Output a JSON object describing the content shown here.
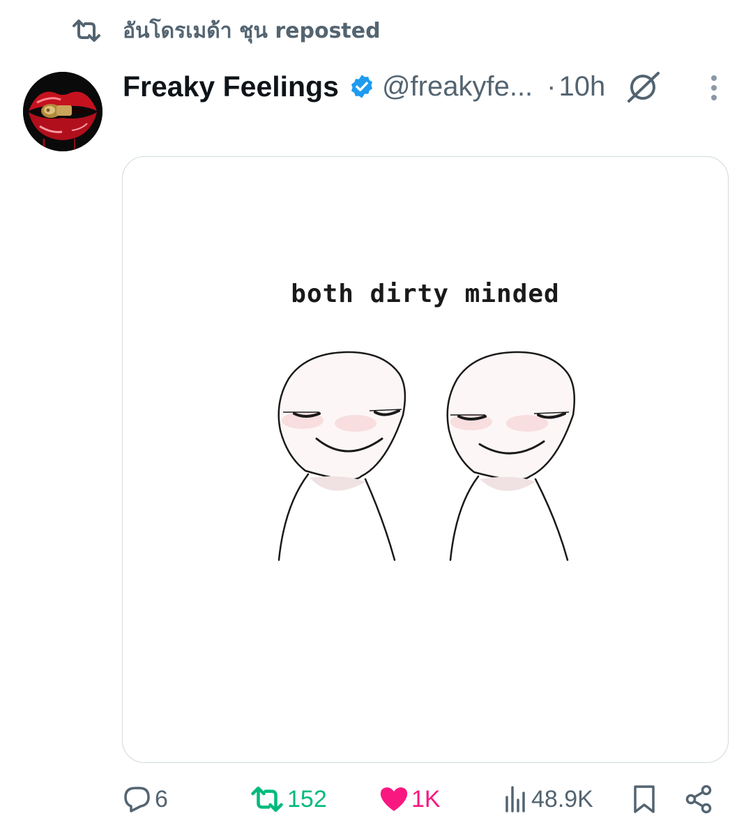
{
  "social_context": {
    "reposter": "อันโดรเมด้า ชุน",
    "label": "reposted",
    "text": "อันโดรเมด้า ชุน reposted",
    "icon": "repost-icon"
  },
  "post": {
    "author": {
      "display_name": "Freaky Feelings",
      "handle": "@freakyfe...",
      "verified": true,
      "verified_color": "#1d9bf0",
      "avatar_icon": "avatar-lips-bullet"
    },
    "separator": "·",
    "time": "10h",
    "media": {
      "caption_text": "both dirty minded"
    },
    "actions": {
      "reply": {
        "icon": "reply-icon",
        "count": "6"
      },
      "repost": {
        "icon": "repost-icon",
        "count": "152",
        "active": true,
        "color": "#00ba7c"
      },
      "like": {
        "icon": "heart-icon",
        "count": "1K",
        "active": true,
        "color": "#f91880"
      },
      "views": {
        "icon": "views-icon",
        "count": "48.9K"
      },
      "bookmark": {
        "icon": "bookmark-icon"
      },
      "share": {
        "icon": "share-icon"
      }
    }
  },
  "colors": {
    "text_primary": "#0f1419",
    "text_secondary": "#536471",
    "border": "#cfd9de"
  }
}
